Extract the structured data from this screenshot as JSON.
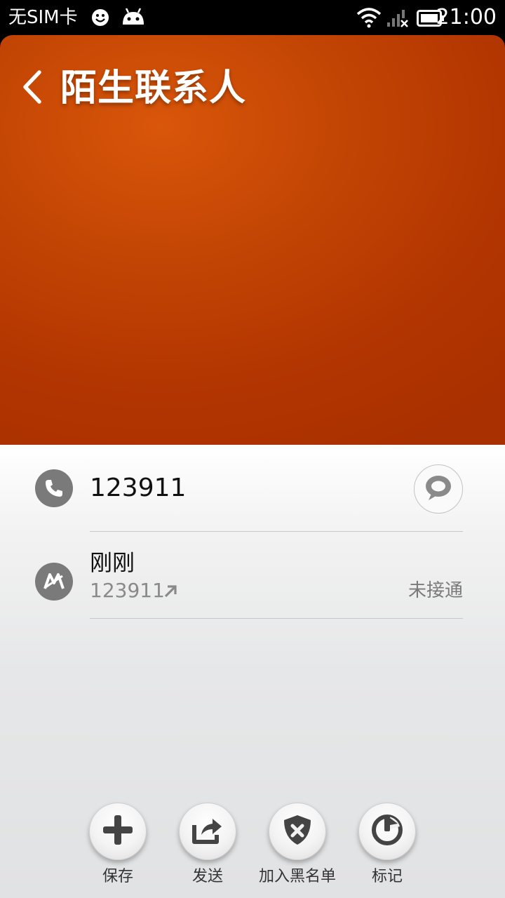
{
  "status_bar": {
    "carrier": "无SIM卡",
    "time": "21:00"
  },
  "header": {
    "title": "陌生联系人",
    "back_icon": "chevron-left-icon",
    "background_color": "#c44604"
  },
  "contact": {
    "phone_number": "123911"
  },
  "call_log": {
    "time": "刚刚",
    "number": "123911",
    "status": "未接通"
  },
  "actions": [
    {
      "label": "保存",
      "icon": "plus-icon"
    },
    {
      "label": "发送",
      "icon": "share-icon"
    },
    {
      "label": "加入黑名单",
      "icon": "shield-x-icon"
    },
    {
      "label": "标记",
      "icon": "mark-icon"
    }
  ]
}
